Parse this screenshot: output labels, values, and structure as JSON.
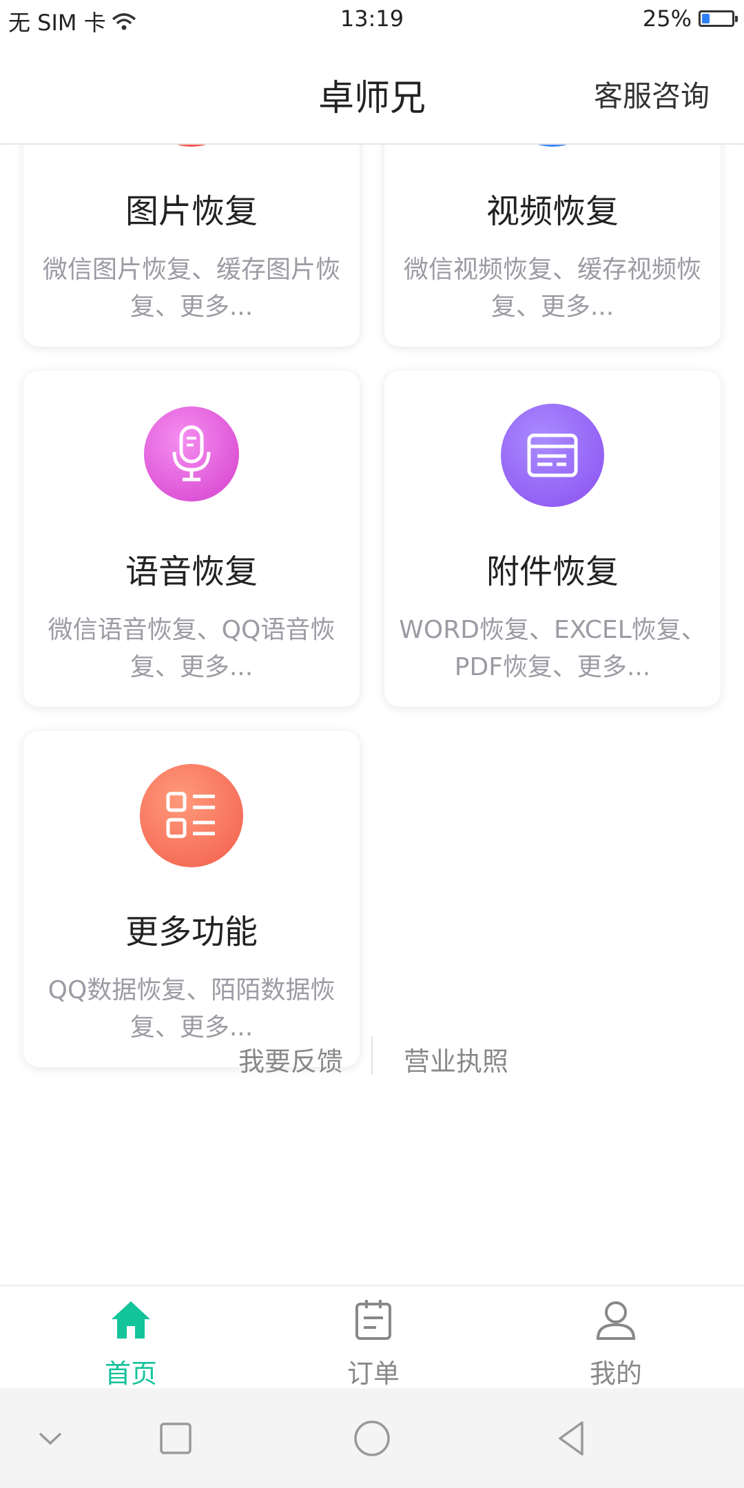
{
  "status_bar": {
    "carrier": "无 SIM 卡",
    "time": "13:19",
    "battery_text": "25%",
    "battery_level": 0.25
  },
  "header": {
    "title": "卓师兄",
    "service_label": "客服咨询"
  },
  "cards": [
    {
      "title": "图片恢复",
      "desc": "微信图片恢复、缓存图片恢复、更多...",
      "icon": "image-icon",
      "color": "#f3504b"
    },
    {
      "title": "视频恢复",
      "desc": "微信视频恢复、缓存视频恢复、更多...",
      "icon": "video-icon",
      "color": "#3f86f4"
    },
    {
      "title": "语音恢复",
      "desc": "微信语音恢复、QQ语音恢复、更多...",
      "icon": "microphone-icon",
      "color": "#dc4fd3"
    },
    {
      "title": "附件恢复",
      "desc": "WORD恢复、EXCEL恢复、PDF恢复、更多...",
      "icon": "attachment-icon",
      "color": "#9062f0"
    },
    {
      "title": "更多功能",
      "desc": "QQ数据恢复、陌陌数据恢复、更多...",
      "icon": "list-icon",
      "color": "#f5705a"
    }
  ],
  "footer": {
    "feedback": "我要反馈",
    "license": "营业执照"
  },
  "tabs": [
    {
      "label": "首页",
      "icon": "home-icon",
      "active": true
    },
    {
      "label": "订单",
      "icon": "order-icon",
      "active": false
    },
    {
      "label": "我的",
      "icon": "profile-icon",
      "active": false
    }
  ],
  "colors": {
    "accent": "#13c39a",
    "desc_text": "#9b9ba3"
  }
}
